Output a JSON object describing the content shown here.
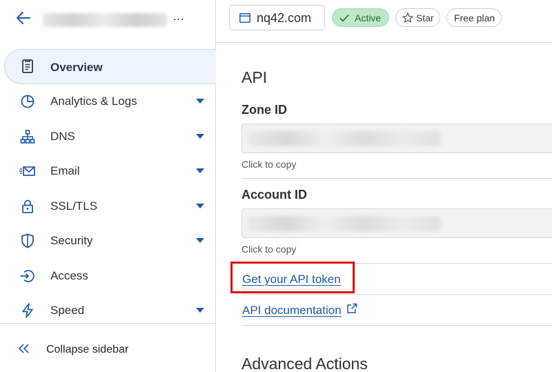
{
  "sidebar": {
    "account_ellipsis": "...",
    "items": [
      {
        "label": "Overview",
        "icon": "document-icon",
        "active": true,
        "expandable": false
      },
      {
        "label": "Analytics & Logs",
        "icon": "pie-chart-icon",
        "expandable": true
      },
      {
        "label": "DNS",
        "icon": "network-icon",
        "expandable": true
      },
      {
        "label": "Email",
        "icon": "email-icon",
        "expandable": true
      },
      {
        "label": "SSL/TLS",
        "icon": "lock-icon",
        "expandable": true
      },
      {
        "label": "Security",
        "icon": "shield-icon",
        "expandable": true
      },
      {
        "label": "Access",
        "icon": "access-icon",
        "expandable": false
      },
      {
        "label": "Speed",
        "icon": "lightning-icon",
        "expandable": true
      }
    ],
    "collapse_label": "Collapse sidebar"
  },
  "topbar": {
    "domain": "nq42.com",
    "status_badge": "Active",
    "star_label": "Star",
    "plan_label": "Free plan"
  },
  "main": {
    "api_title": "API",
    "zone_id_label": "Zone ID",
    "zone_id_hint": "Click to copy",
    "account_id_label": "Account ID",
    "account_id_hint": "Click to copy",
    "api_token_link": "Get your API token",
    "api_docs_link": "API documentation",
    "advanced_title": "Advanced Actions"
  },
  "colors": {
    "accent_link": "#1f5aa6",
    "active_badge_bg": "#bfe8c9",
    "highlight_border": "#e10b0b",
    "active_nav_bg": "#eef4fb"
  }
}
